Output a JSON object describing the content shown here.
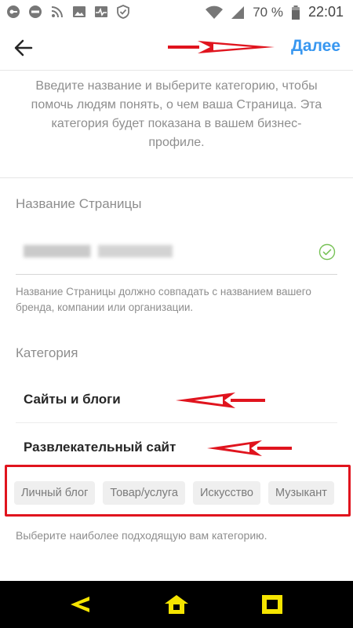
{
  "status_bar": {
    "battery": "70 %",
    "time": "22:01"
  },
  "header": {
    "next_label": "Далее"
  },
  "intro_text": "Введите название и выберите категорию, чтобы помочь людям понять, о чем ваша Страница. Эта категория будет показана в вашем бизнес-профиле.",
  "page_name": {
    "label": "Название Страницы",
    "hint": "Название Страницы должно совпадать с названием вашего бренда, компании или организации."
  },
  "category": {
    "label": "Категория",
    "selected": [
      "Сайты и блоги",
      "Развлекательный сайт"
    ],
    "chips": [
      "Личный блог",
      "Товар/услуга",
      "Искусство",
      "Музыкант"
    ],
    "hint": "Выберите наиболее подходящую вам категорию."
  },
  "colors": {
    "accent": "#3897f0",
    "annotation": "#e0141e",
    "nav_icons": "#f5e400"
  }
}
